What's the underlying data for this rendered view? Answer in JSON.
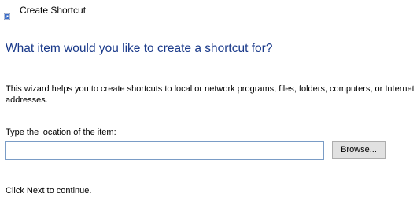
{
  "window": {
    "title": "Create Shortcut",
    "icon": "shortcut-wizard-icon"
  },
  "main": {
    "heading": "What item would you like to create a shortcut for?",
    "description": "This wizard helps you to create shortcuts to local or network programs, files, folders, computers, or Internet addresses.",
    "location_label": "Type the location of the item:",
    "location_value": "",
    "location_placeholder": "",
    "browse_label": "Browse...",
    "footer": "Click Next to continue."
  },
  "colors": {
    "heading": "#1a3a8a",
    "input_border": "#7a9cc6",
    "button_face": "#e1e1e1",
    "button_border": "#adadad"
  }
}
